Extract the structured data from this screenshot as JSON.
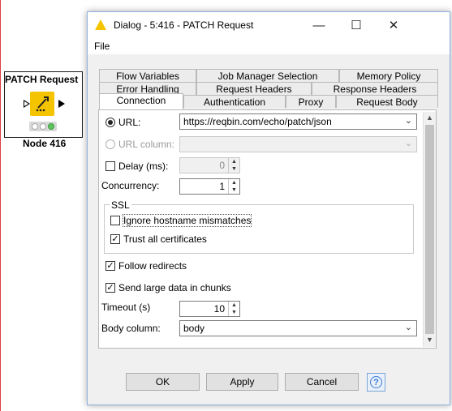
{
  "node": {
    "title": "PATCH Request",
    "label": "Node 416"
  },
  "dialog": {
    "title": "Dialog - 5:416 - PATCH Request",
    "menu_file": "File",
    "tabs_row1": [
      "Flow Variables",
      "Job Manager Selection",
      "Memory Policy"
    ],
    "tabs_row2": [
      "Error Handling",
      "Request Headers",
      "Response Headers"
    ],
    "tabs_row3": [
      "Connection",
      "Authentication",
      "Proxy",
      "Request Body"
    ],
    "active_tab": "Connection",
    "url_label": "URL:",
    "url_value": "https://reqbin.com/echo/patch/json",
    "url_column_label": "URL column:",
    "url_column_value": "",
    "delay_label": "Delay (ms):",
    "delay_value": "0",
    "concurrency_label": "Concurrency:",
    "concurrency_value": "1",
    "ssl_title": "SSL",
    "ignore_hostname_label": "Ignore hostname mismatches",
    "trust_all_label": "Trust all certificates",
    "follow_redirects_label": "Follow redirects",
    "send_chunks_label": "Send large data in chunks",
    "timeout_label": "Timeout (s)",
    "timeout_value": "10",
    "body_column_label": "Body column:",
    "body_column_value": "body",
    "ok_label": "OK",
    "apply_label": "Apply",
    "cancel_label": "Cancel",
    "help_icon": "?"
  },
  "state": {
    "url_selected": true,
    "delay_checked": false,
    "ignore_hostname_checked": false,
    "trust_all_checked": true,
    "follow_redirects_checked": true,
    "send_chunks_checked": true
  },
  "colors": {
    "node_icon": "#f5c400",
    "dialog_border": "#8fb0e0",
    "help_blue": "#3a7bd5"
  }
}
